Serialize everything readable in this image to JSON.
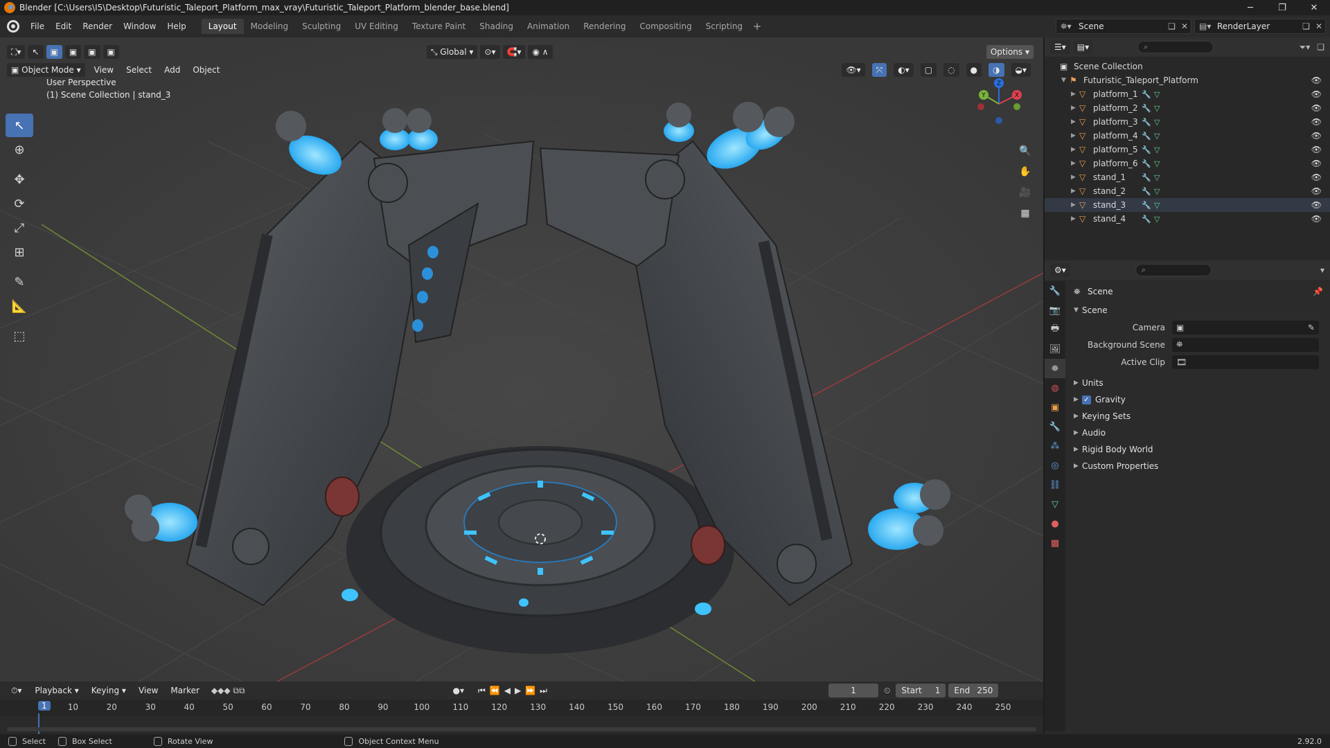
{
  "window": {
    "title": "Blender [C:\\Users\\I5\\Desktop\\Futuristic_Taleport_Platform_max_vray\\Futuristic_Taleport_Platform_blender_base.blend]",
    "minimize": "─",
    "maximize": "❐",
    "close": "✕"
  },
  "menu": {
    "items": [
      "File",
      "Edit",
      "Render",
      "Window",
      "Help"
    ]
  },
  "workspaces": [
    "Layout",
    "Modeling",
    "Sculpting",
    "UV Editing",
    "Texture Paint",
    "Shading",
    "Animation",
    "Rendering",
    "Compositing",
    "Scripting"
  ],
  "workspace_plus": "+",
  "scene": {
    "name": "Scene",
    "render_layer": "RenderLayer"
  },
  "viewport": {
    "mode": "Object Mode",
    "menus": [
      "View",
      "Select",
      "Add",
      "Object"
    ],
    "orientation": "Global",
    "options": "Options",
    "view_name": "User Perspective",
    "collection_info": "(1) Scene Collection | stand_3",
    "gizmo_axes": {
      "x": "X",
      "y": "Y",
      "z": "Z"
    }
  },
  "outliner": {
    "root": "Scene Collection",
    "collection": "Futuristic_Taleport_Platform",
    "objects": [
      "platform_1",
      "platform_2",
      "platform_3",
      "platform_4",
      "platform_5",
      "platform_6",
      "stand_1",
      "stand_2",
      "stand_3",
      "stand_4"
    ],
    "selected": "stand_3"
  },
  "properties": {
    "context": "Scene",
    "panel": "Scene",
    "fields": [
      {
        "label": "Camera",
        "value": ""
      },
      {
        "label": "Background Scene",
        "value": ""
      },
      {
        "label": "Active Clip",
        "value": ""
      }
    ],
    "subpanels": [
      "Units",
      "Gravity",
      "Keying Sets",
      "Audio",
      "Rigid Body World",
      "Custom Properties"
    ],
    "gravity_checked": true
  },
  "timeline": {
    "menus": [
      "Playback",
      "Keying",
      "View",
      "Marker"
    ],
    "current_frame": "1",
    "start_label": "Start",
    "start": "1",
    "end_label": "End",
    "end": "250",
    "ruler": [
      "1",
      "10",
      "20",
      "30",
      "40",
      "50",
      "60",
      "70",
      "80",
      "90",
      "100",
      "110",
      "120",
      "130",
      "140",
      "150",
      "160",
      "170",
      "180",
      "190",
      "200",
      "210",
      "220",
      "230",
      "240",
      "250"
    ]
  },
  "status": {
    "select": "Select",
    "box_select": "Box Select",
    "rotate": "Rotate View",
    "context_menu": "Object Context Menu",
    "version": "2.92.0"
  },
  "colors": {
    "accent": "#4772b3",
    "object_orange": "#f0a04b",
    "mesh_green": "#64d08c",
    "glow_blue": "#3ec3ff"
  }
}
